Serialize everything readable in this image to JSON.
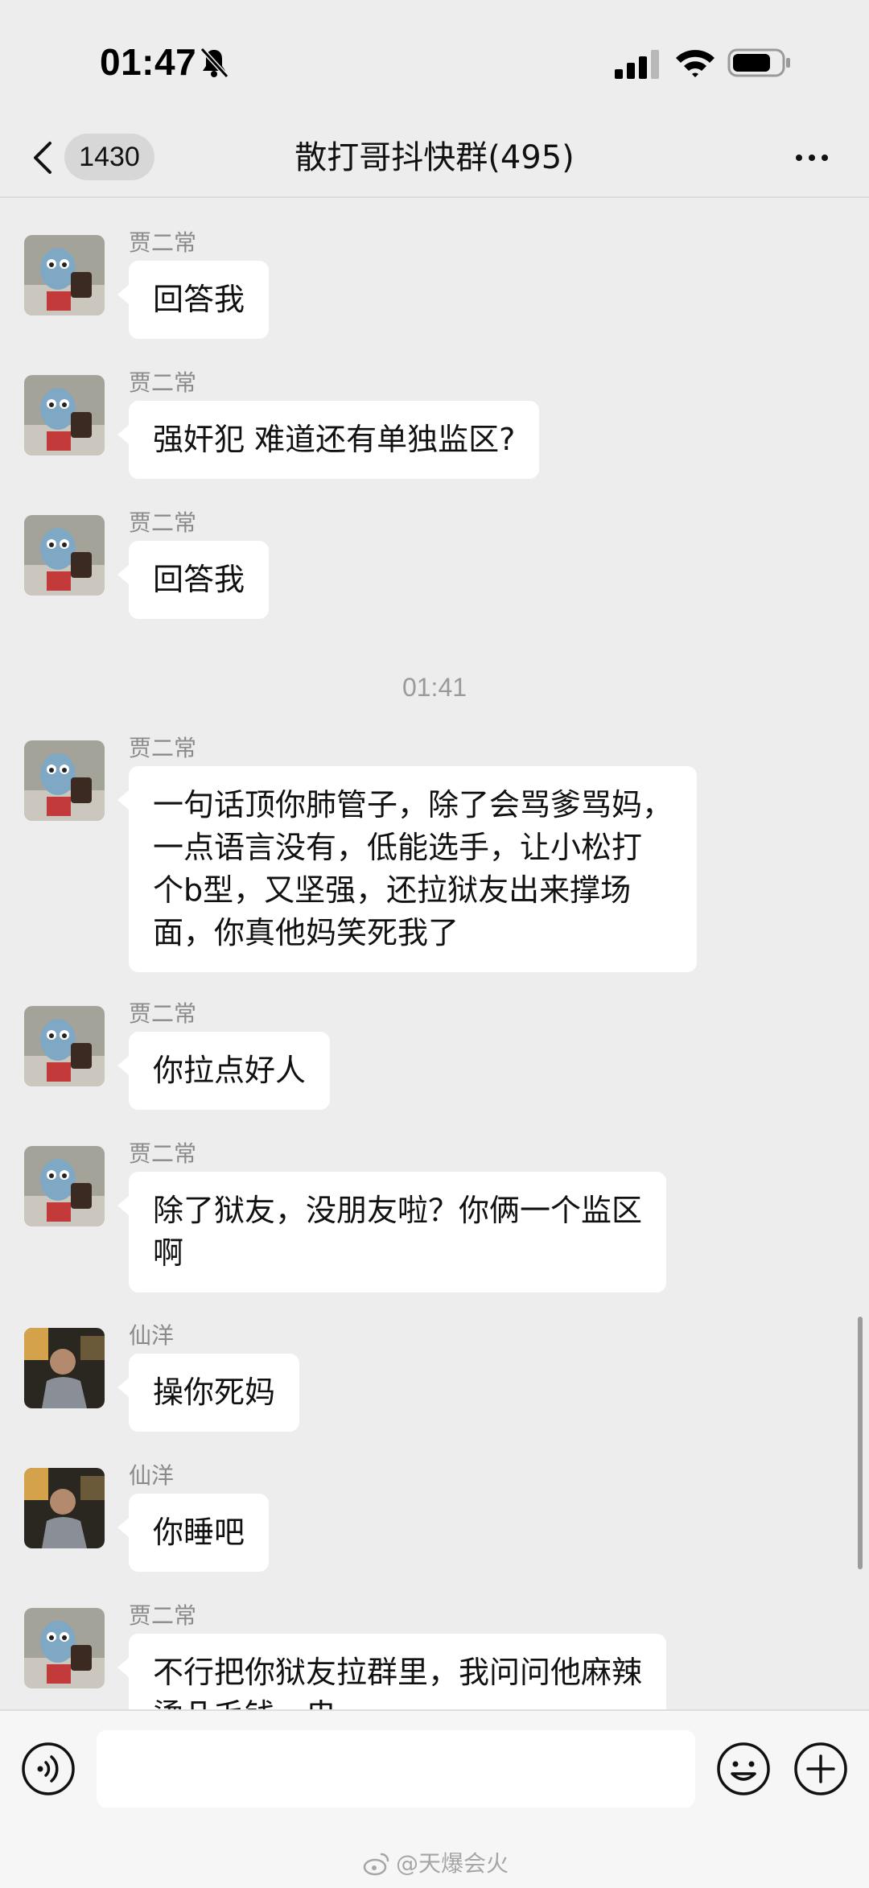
{
  "status_bar": {
    "time": "01:47"
  },
  "nav": {
    "unread_count": "1430",
    "title": "散打哥抖快群(495)"
  },
  "timestamp": "01:41",
  "messages": [
    {
      "sender": "贾二常",
      "text": "回答我"
    },
    {
      "sender": "贾二常",
      "text": "强奸犯 难道还有单独监区?"
    },
    {
      "sender": "贾二常",
      "text": "回答我"
    },
    {
      "sender": "贾二常",
      "text": "一句话顶你肺管子，除了会骂爹骂妈，\n一点语言没有，低能选手，让小松打\n个b型，又坚强，还拉狱友出来撑场\n面，你真他妈笑死我了"
    },
    {
      "sender": "贾二常",
      "text": "你拉点好人"
    },
    {
      "sender": "贾二常",
      "text": "除了狱友，没朋友啦？你俩一个监区\n啊"
    },
    {
      "sender": "仙洋",
      "text": "操你死妈"
    },
    {
      "sender": "仙洋",
      "text": "你睡吧"
    },
    {
      "sender": "贾二常",
      "text": "不行把你狱友拉群里，我问问他麻辣\n烫几毛钱一串"
    }
  ],
  "watermark": "@天爆会火"
}
